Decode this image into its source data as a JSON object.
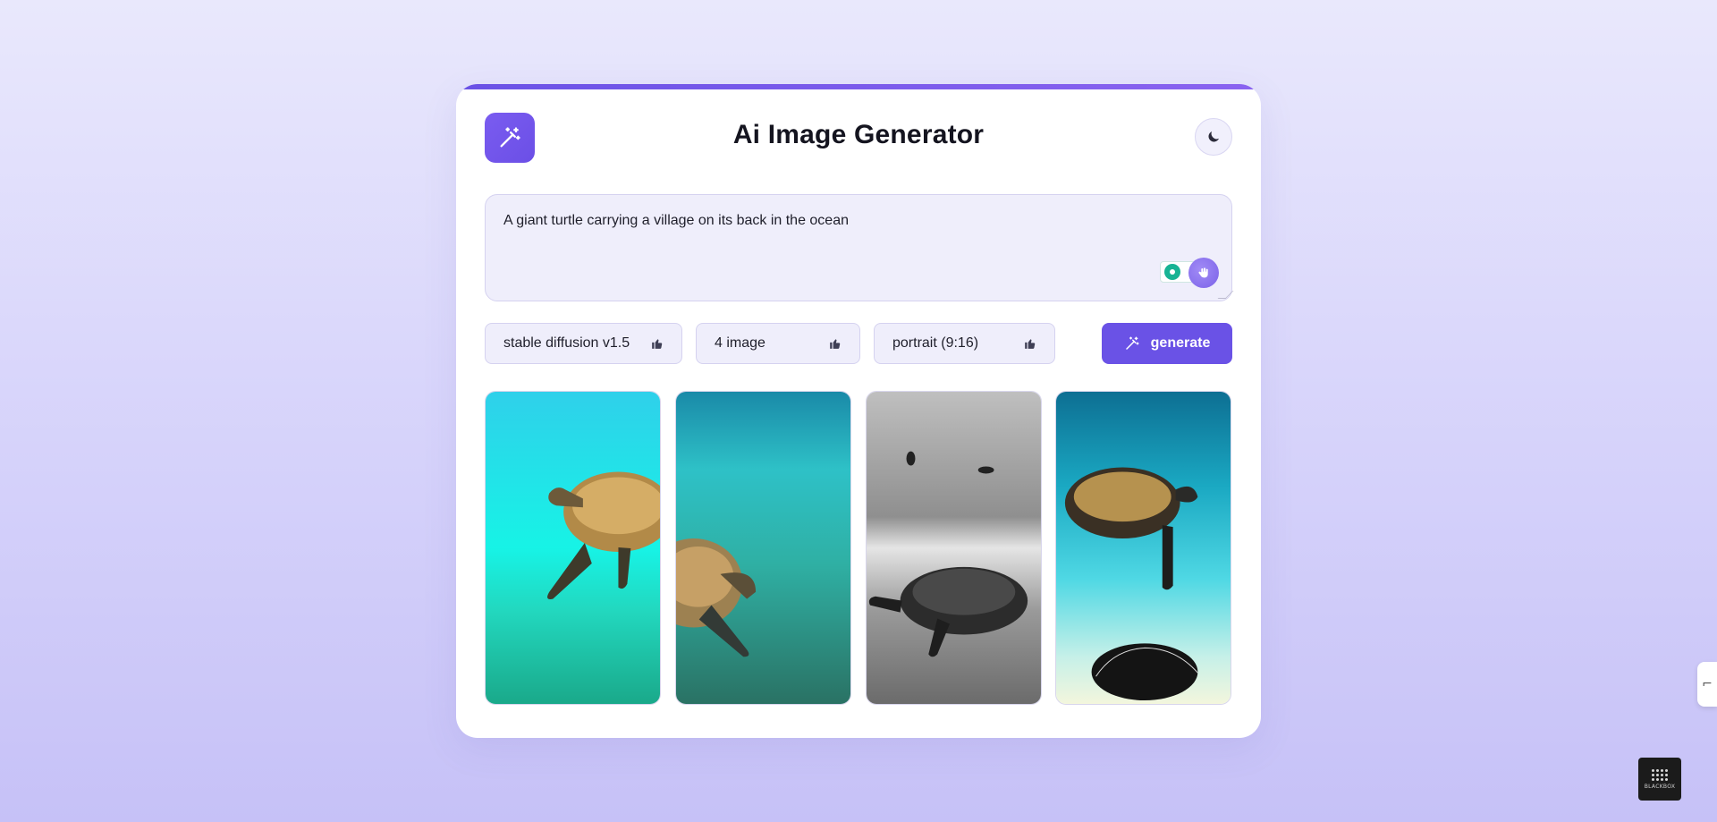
{
  "app": {
    "title": "Ai Image Generator",
    "logo_icon": "magic-wand-icon",
    "theme_toggle_icon": "moon-icon"
  },
  "prompt": {
    "value": "A giant turtle carrying a village on its back in the ocean"
  },
  "controls": {
    "model": {
      "selected": "stable diffusion v1.5",
      "icon": "thumbs-up-icon"
    },
    "image_count": {
      "selected": "4 image",
      "icon": "thumbs-up-icon"
    },
    "aspect_ratio": {
      "selected": "portrait (9:16)",
      "icon": "thumbs-up-icon"
    },
    "generate_label": "generate",
    "generate_icon": "magic-wand-icon"
  },
  "gallery": {
    "images": [
      {
        "subject": "sea turtle swimming over turquoise water"
      },
      {
        "subject": "sea turtle swimming in deep green water"
      },
      {
        "subject": "black and white turtle on ocean floor"
      },
      {
        "subject": "two turtles in blue water, one swimming, one below"
      }
    ]
  },
  "widgets": {
    "side_tab_glyph": "⌐",
    "blackbox_label": "BLACKBOX"
  },
  "colors": {
    "accent": "#6a52e6",
    "accent_light": "#efeefb",
    "background_top": "#e9e8fc",
    "background_bottom": "#c6c1f7"
  }
}
